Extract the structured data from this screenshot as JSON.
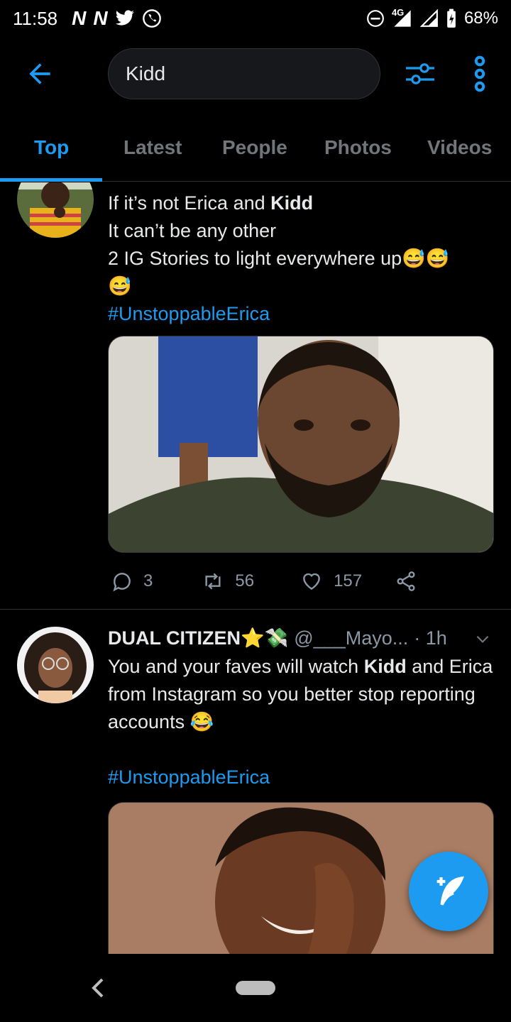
{
  "status_bar": {
    "time": "11:58",
    "notification_icons": [
      "N",
      "N"
    ],
    "battery": "68%",
    "network": "4G"
  },
  "search": {
    "value": "Kidd"
  },
  "tabs": [
    {
      "label": "Top",
      "active": true
    },
    {
      "label": "Latest",
      "active": false
    },
    {
      "label": "People",
      "active": false
    },
    {
      "label": "Photos",
      "active": false
    },
    {
      "label": "Videos",
      "active": false
    }
  ],
  "tweets": [
    {
      "text_line1_pre": "If it’s not Erica and ",
      "text_line1_bold": "Kidd",
      "text_line2": "It can’t be any other",
      "text_line3": "2 IG Stories to light everywhere up",
      "hashtag": "#UnstoppableErica",
      "replies": "3",
      "retweets": "56",
      "likes": "157"
    },
    {
      "name": "DUAL CITIZEN",
      "handle": "@___Mayo...",
      "time": "· 1h",
      "text_a": "You and your faves will watch ",
      "text_bold": "Kidd",
      "text_b": " and Erica from Instagram so you better stop reporting accounts",
      "hashtag": "#UnstoppableErica"
    }
  ],
  "colors": {
    "accent": "#1d9bf0",
    "background": "#000000",
    "muted": "#71767b"
  }
}
